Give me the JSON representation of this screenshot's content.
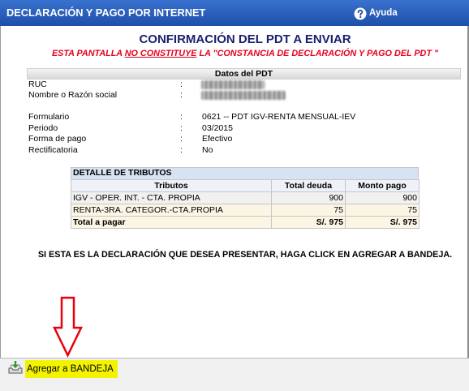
{
  "header": {
    "title": "DECLARACIÓN Y PAGO POR INTERNET",
    "help_label": "Ayuda",
    "help_icon": "question-circle-icon"
  },
  "confirmation": {
    "title": "CONFIRMACIÓN DEL PDT A ENVIAR",
    "warning_pre": "ESTA PANTALLA ",
    "warning_emphasis": "NO CONSTITUYE",
    "warning_post": " LA \"CONSTANCIA DE DECLARACIÓN Y PAGO DEL PDT \""
  },
  "pdt_data": {
    "section_title": "Datos del PDT",
    "fields": [
      {
        "label": "RUC",
        "separator": ":"
      },
      {
        "label": "Nombre o Razón social",
        "separator": ":"
      },
      {
        "label": "Formulario",
        "separator": ":",
        "value": "0621 -- PDT IGV-RENTA MENSUAL-IEV"
      },
      {
        "label": "Periodo",
        "separator": ":",
        "value": "03/2015"
      },
      {
        "label": "Forma de pago",
        "separator": ":",
        "value": "Efectivo"
      },
      {
        "label": "Rectificatoria",
        "separator": ":",
        "value": "No"
      }
    ]
  },
  "tributos": {
    "title": "DETALLE DE TRIBUTOS",
    "columns": [
      "Tributos",
      "Total deuda",
      "Monto pago"
    ],
    "rows": [
      {
        "tributo": "IGV - OPER. INT. - CTA. PROPIA",
        "total_deuda": "900",
        "monto_pago": "900"
      },
      {
        "tributo": "RENTA-3RA. CATEGOR.-CTA.PROPIA",
        "total_deuda": "75",
        "monto_pago": "75"
      }
    ],
    "total": {
      "label": "Total a pagar",
      "total_deuda": "S/. 975",
      "monto_pago": "S/. 975"
    }
  },
  "instruction": "SI ESTA ES LA DECLARACIÓN QUE DESEA PRESENTAR, HAGA CLICK EN AGREGAR A BANDEJA.",
  "toolbar": {
    "add_label": "Agregar a BANDEJA",
    "add_icon": "add-to-tray-icon"
  },
  "annotation": {
    "arrow_icon": "down-arrow-icon",
    "arrow_color": "#e8000a",
    "highlight_color": "#f3f300"
  },
  "colors": {
    "header_blue": "#1c4fa8",
    "title_navy": "#1a1f6e",
    "warning_red": "#e6001e"
  }
}
